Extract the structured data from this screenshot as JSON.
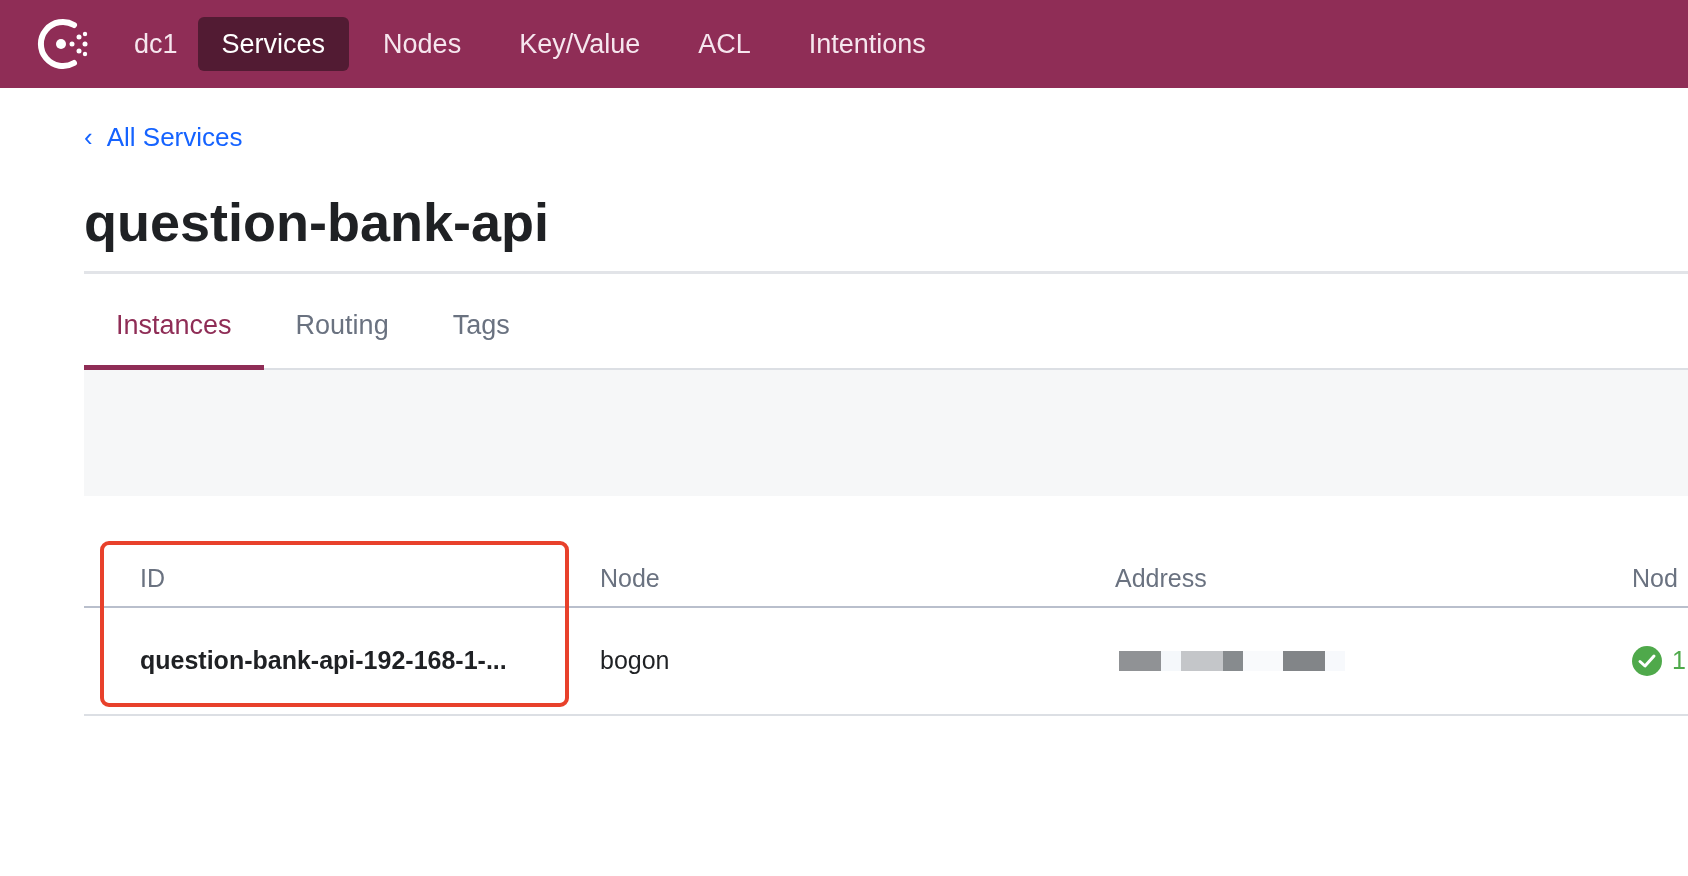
{
  "nav": {
    "datacenter": "dc1",
    "items": [
      {
        "label": "Services",
        "selected": true
      },
      {
        "label": "Nodes",
        "selected": false
      },
      {
        "label": "Key/Value",
        "selected": false
      },
      {
        "label": "ACL",
        "selected": false
      },
      {
        "label": "Intentions",
        "selected": false
      }
    ]
  },
  "breadcrumb": {
    "arrow": "‹",
    "label": "All Services"
  },
  "title": "question-bank-api",
  "tabs": [
    {
      "label": "Instances",
      "selected": true
    },
    {
      "label": "Routing",
      "selected": false
    },
    {
      "label": "Tags",
      "selected": false
    }
  ],
  "table": {
    "columns": [
      "ID",
      "Node",
      "Address",
      "Nod"
    ],
    "rows": [
      {
        "id": "question-bank-api-192-168-1-...",
        "node": "bogon",
        "address_redacted": true,
        "checks": "1"
      }
    ]
  }
}
